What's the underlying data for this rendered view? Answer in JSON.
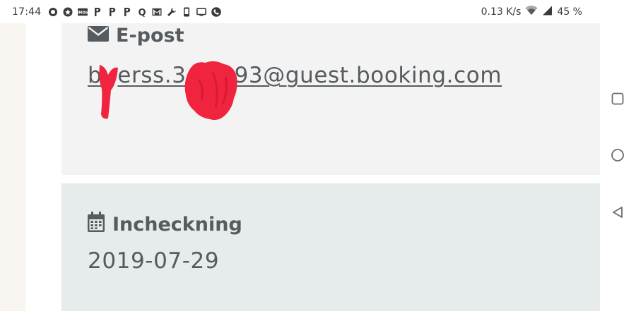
{
  "status_bar": {
    "time": "17:44",
    "notification_icons": [
      {
        "name": "circle-icon",
        "glyph": "⬤"
      },
      {
        "name": "badge-icon",
        "glyph": "✿"
      },
      {
        "name": "imdb-icon",
        "glyph": "IMDb"
      },
      {
        "name": "parking-icon",
        "glyph": "P"
      },
      {
        "name": "parking-icon",
        "glyph": "P"
      },
      {
        "name": "parking-icon",
        "glyph": "P"
      },
      {
        "name": "quora-icon",
        "glyph": "Q"
      },
      {
        "name": "gmail-icon",
        "glyph": "M"
      },
      {
        "name": "wrench-icon",
        "glyph": "🔧"
      },
      {
        "name": "phone-icon",
        "glyph": "▯"
      },
      {
        "name": "tv-icon",
        "glyph": "▭"
      },
      {
        "name": "call-icon",
        "glyph": "✆"
      }
    ],
    "network_speed": "0.13 K/s",
    "battery": "45 %"
  },
  "email_card": {
    "label": "E-post",
    "icon": "envelope-icon",
    "value": "bookerss.3••••93@guest.booking.com",
    "value_parts": [
      "b",
      "erss.3",
      "93@guest.booking.com"
    ]
  },
  "checkin_card": {
    "label": "Incheckning",
    "icon": "calendar-icon",
    "value": "2019-07-29"
  },
  "nav_bar": {
    "buttons": [
      "recents-button",
      "home-button",
      "back-button"
    ]
  },
  "colors": {
    "text": "#555b5f",
    "email_card_bg": "#f3f3f3",
    "checkin_card_bg": "#e6ebeb",
    "redaction": "#f0243f",
    "left_strip": "#f8f5f1"
  }
}
